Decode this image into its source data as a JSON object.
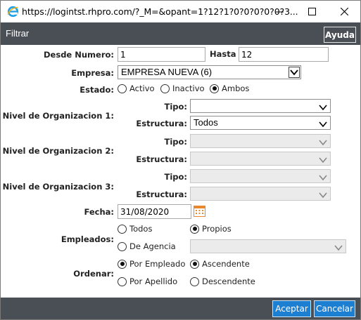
{
  "window": {
    "url": "https://logintst.rhpro.com/?_M=&opant=1?12?1?0?0?0?0?0?3..."
  },
  "header": {
    "title": "Filtrar",
    "help_label": "Ayuda"
  },
  "form": {
    "desde_label": "Desde Numero:",
    "desde_value": "1",
    "hasta_label": "Hasta",
    "hasta_value": "12",
    "empresa_label": "Empresa:",
    "empresa_value": "EMPRESA NUEVA (6)",
    "estado_label": "Estado:",
    "estado_options": [
      "Activo",
      "Inactivo",
      "Ambos"
    ],
    "estado_selected": "Ambos",
    "nivel1_label": "Nivel de Organizacion 1:",
    "nivel2_label": "Nivel de Organizacion 2:",
    "nivel3_label": "Nivel de Organizacion 3:",
    "tipo_label": "Tipo:",
    "estructura_label": "Estructura:",
    "nivel1_tipo_value": "",
    "nivel1_estructura_value": "Todos",
    "fecha_label": "Fecha:",
    "fecha_value": "31/08/2020",
    "empleados_label": "Empleados:",
    "empleados_options": [
      "Todos",
      "Propios",
      "De Agencia"
    ],
    "empleados_selected": "Propios",
    "ordenar_label": "Ordenar:",
    "ordenar_campo_options": [
      "Por Empleado",
      "Por Apellido"
    ],
    "ordenar_campo_selected": "Por Empleado",
    "ordenar_dir_options": [
      "Ascendente",
      "Descendente"
    ],
    "ordenar_dir_selected": "Ascendente"
  },
  "footer": {
    "accept_label": "Aceptar",
    "cancel_label": "Cancelar"
  },
  "colors": {
    "bar": "#4a4e55",
    "button_blue": "#1d7fd1"
  }
}
